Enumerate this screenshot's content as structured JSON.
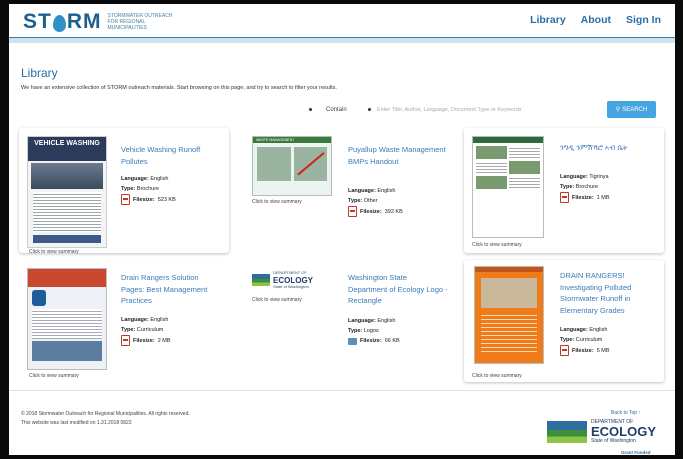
{
  "header": {
    "logo_text_1": "ST",
    "logo_text_2": "RM",
    "logo_tagline": "Stormwater Outreach for Regional Municipalities",
    "nav": [
      "Library",
      "About",
      "Sign In"
    ]
  },
  "library": {
    "title": "Library",
    "intro": "We have an extensive collection of STORM outreach materials. Start browsing on this page, and try to search to filter your results.",
    "select_value": "Contain",
    "search_placeholder": "Enter Title, Author, Language, Document Type or Keywords",
    "search_button": "SEARCH"
  },
  "labels": {
    "language": "Language:",
    "type": "Type:",
    "filesize": "Filesize:",
    "view_summary": "Click to view summary"
  },
  "cards": [
    {
      "title": "Vehicle Washing Runoff Pollutes",
      "language": "English",
      "type": "Brochure",
      "filesize": "523 KB",
      "thumb_text": "VEHICLE WASHING",
      "icon": "pdf-icon"
    },
    {
      "title": "Puyallup Waste Management BMPs Handout",
      "language": "English",
      "type": "Other",
      "filesize": "392 KB",
      "thumb_text": "WASTE MANAGEMENT",
      "icon": "pdf-icon"
    },
    {
      "title": "ንግዲ ንምሽኻሮ ኣብ ቤት",
      "language": "Tigrinya",
      "type": "Brochure",
      "filesize": "1 MB",
      "icon": "pdf-icon"
    },
    {
      "title": "Drain Rangers Solution Pages: Best Management Practices",
      "language": "English",
      "type": "Curriculum",
      "filesize": "2 MB",
      "icon": "pdf-icon"
    },
    {
      "title": "Washington State Department of Ecology Logo - Rectangle",
      "language": "English",
      "type": "Logos",
      "filesize": "66 KB",
      "thumb_text_1": "DEPARTMENT OF",
      "thumb_text_2": "ECOLOGY",
      "thumb_text_3": "State of Washington",
      "icon": "image-icon"
    },
    {
      "title": "DRAIN RANGERS! Investigating Polluted Stormwater Runoff in Elementary Grades",
      "language": "English",
      "type": "Curriculum",
      "filesize": "5 MB",
      "icon": "pdf-icon"
    }
  ],
  "footer": {
    "copyright": "© 2018 Stormwater Outreach for Regional Municipalities. All rights reserved.",
    "modified": "This website was last modified on 1.31.2018 0822",
    "back_to_top": "Back to Top ↑",
    "ecology_1": "DEPARTMENT OF",
    "ecology_2": "ECOLOGY",
    "ecology_3": "State of Washington",
    "grant": "Grant Funded"
  }
}
